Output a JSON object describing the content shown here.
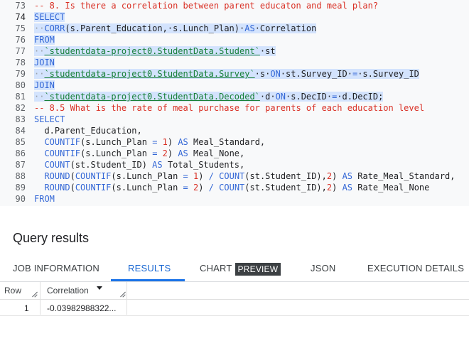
{
  "editor": {
    "lines": [
      {
        "num": "73",
        "segments": [
          {
            "t": "-- 8. Is there a correlation between parent educaton and meal plan?",
            "c": "cm"
          }
        ]
      },
      {
        "num": "74",
        "current": true,
        "segments": [
          {
            "t": "SELECT",
            "c": "kw sel"
          }
        ]
      },
      {
        "num": "75",
        "segments": [
          {
            "t": "··",
            "c": "dots sel"
          },
          {
            "t": "CORR",
            "c": "fn sel"
          },
          {
            "t": "(s.Parent_Education,·s.Lunch_Plan)·",
            "c": "id sel"
          },
          {
            "t": "AS",
            "c": "kw sel"
          },
          {
            "t": "·Correlation",
            "c": "id sel"
          }
        ]
      },
      {
        "num": "76",
        "segments": [
          {
            "t": "FROM",
            "c": "kw sel"
          }
        ]
      },
      {
        "num": "77",
        "segments": [
          {
            "t": "··",
            "c": "dots sel"
          },
          {
            "t": "`studentdata-project0.StudentData.Student`",
            "c": "tbl sel"
          },
          {
            "t": "·st",
            "c": "id sel"
          }
        ]
      },
      {
        "num": "78",
        "segments": [
          {
            "t": "JOIN",
            "c": "kw sel"
          }
        ]
      },
      {
        "num": "79",
        "segments": [
          {
            "t": "··",
            "c": "dots sel"
          },
          {
            "t": "`studentdata-project0.StudentData.Survey`",
            "c": "tbl sel"
          },
          {
            "t": "·s·",
            "c": "id sel"
          },
          {
            "t": "ON",
            "c": "kw sel"
          },
          {
            "t": "·st.Survey_ID·",
            "c": "id sel"
          },
          {
            "t": "=",
            "c": "op sel"
          },
          {
            "t": "·s.Survey_ID",
            "c": "id sel"
          }
        ]
      },
      {
        "num": "80",
        "segments": [
          {
            "t": "JOIN",
            "c": "kw sel"
          }
        ]
      },
      {
        "num": "81",
        "segments": [
          {
            "t": "··",
            "c": "dots sel"
          },
          {
            "t": "`studentdata-project0.StudentData.Decoded`",
            "c": "tbl sel"
          },
          {
            "t": "·d·",
            "c": "id sel"
          },
          {
            "t": "ON",
            "c": "kw sel"
          },
          {
            "t": "·s.DecID·",
            "c": "id sel"
          },
          {
            "t": "=",
            "c": "op sel"
          },
          {
            "t": "·d.DecID;",
            "c": "id sel"
          }
        ]
      },
      {
        "num": "82",
        "segments": [
          {
            "t": "-- 8.5 What is the rate of meal purchase for parents of each education level",
            "c": "cm"
          }
        ]
      },
      {
        "num": "83",
        "segments": [
          {
            "t": "SELECT",
            "c": "kw"
          }
        ]
      },
      {
        "num": "84",
        "segments": [
          {
            "t": "  d.Parent_Education,",
            "c": "id"
          }
        ]
      },
      {
        "num": "85",
        "segments": [
          {
            "t": "  COUNTIF",
            "c": "fn"
          },
          {
            "t": "(s.Lunch_Plan ",
            "c": "id"
          },
          {
            "t": "=",
            "c": "op"
          },
          {
            "t": " 1",
            "c": "num"
          },
          {
            "t": ") ",
            "c": "id"
          },
          {
            "t": "AS",
            "c": "kw"
          },
          {
            "t": " Meal_Standard,",
            "c": "id"
          }
        ]
      },
      {
        "num": "86",
        "segments": [
          {
            "t": "  COUNTIF",
            "c": "fn"
          },
          {
            "t": "(s.Lunch_Plan ",
            "c": "id"
          },
          {
            "t": "=",
            "c": "op"
          },
          {
            "t": " 2",
            "c": "num"
          },
          {
            "t": ") ",
            "c": "id"
          },
          {
            "t": "AS",
            "c": "kw"
          },
          {
            "t": " Meal_None,",
            "c": "id"
          }
        ]
      },
      {
        "num": "87",
        "segments": [
          {
            "t": "  COUNT",
            "c": "fn"
          },
          {
            "t": "(st.Student_ID) ",
            "c": "id"
          },
          {
            "t": "AS",
            "c": "kw"
          },
          {
            "t": " Total_Students,",
            "c": "id"
          }
        ]
      },
      {
        "num": "88",
        "segments": [
          {
            "t": "  ROUND",
            "c": "fn"
          },
          {
            "t": "(",
            "c": "id"
          },
          {
            "t": "COUNTIF",
            "c": "fn"
          },
          {
            "t": "(s.Lunch_Plan ",
            "c": "id"
          },
          {
            "t": "=",
            "c": "op"
          },
          {
            "t": " 1",
            "c": "num"
          },
          {
            "t": ") ",
            "c": "id"
          },
          {
            "t": "/",
            "c": "op"
          },
          {
            "t": " ",
            "c": "id"
          },
          {
            "t": "COUNT",
            "c": "fn"
          },
          {
            "t": "(st.Student_ID),",
            "c": "id"
          },
          {
            "t": "2",
            "c": "num"
          },
          {
            "t": ") ",
            "c": "id"
          },
          {
            "t": "AS",
            "c": "kw"
          },
          {
            "t": " Rate_Meal_Standard,",
            "c": "id"
          }
        ]
      },
      {
        "num": "89",
        "segments": [
          {
            "t": "  ROUND",
            "c": "fn"
          },
          {
            "t": "(",
            "c": "id"
          },
          {
            "t": "COUNTIF",
            "c": "fn"
          },
          {
            "t": "(s.Lunch_Plan ",
            "c": "id"
          },
          {
            "t": "=",
            "c": "op"
          },
          {
            "t": " 2",
            "c": "num"
          },
          {
            "t": ") ",
            "c": "id"
          },
          {
            "t": "/",
            "c": "op"
          },
          {
            "t": " ",
            "c": "id"
          },
          {
            "t": "COUNT",
            "c": "fn"
          },
          {
            "t": "(st.Student_ID),",
            "c": "id"
          },
          {
            "t": "2",
            "c": "num"
          },
          {
            "t": ") ",
            "c": "id"
          },
          {
            "t": "AS",
            "c": "kw"
          },
          {
            "t": " Rate_Meal_None",
            "c": "id"
          }
        ]
      },
      {
        "num": "90",
        "segments": [
          {
            "t": "FROM",
            "c": "kw"
          }
        ]
      }
    ]
  },
  "results": {
    "title": "Query results",
    "tabs": {
      "job_info": "JOB INFORMATION",
      "results": "RESULTS",
      "chart": "CHART",
      "chart_badge": "PREVIEW",
      "json": "JSON",
      "execution": "EXECUTION DETAILS"
    },
    "columns": {
      "row": "Row",
      "correlation": "Correlation"
    },
    "rows": [
      {
        "row": "1",
        "correlation": "-0.03982988322..."
      }
    ]
  },
  "colors": {
    "accent": "#1a73e8",
    "selection": "#d3e3fd",
    "comment": "#d93025",
    "keyword": "#3367d6",
    "table_ref": "#188038"
  }
}
